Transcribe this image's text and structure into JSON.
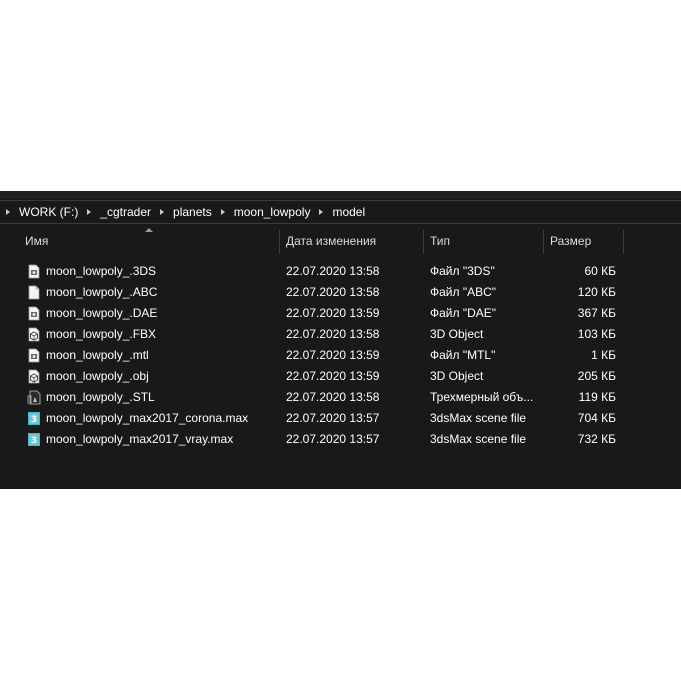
{
  "breadcrumb": [
    "WORK (F:)",
    "_cgtrader",
    "planets",
    "moon_lowpoly",
    "model"
  ],
  "columns": {
    "name": "Имя",
    "date": "Дата изменения",
    "type": "Тип",
    "size": "Размер"
  },
  "files": [
    {
      "name": "moon_lowpoly_.3DS",
      "date": "22.07.2020 13:58",
      "type": "Файл \"3DS\"",
      "size": "60 КБ",
      "icon": "generic-file-icon"
    },
    {
      "name": "moon_lowpoly_.ABC",
      "date": "22.07.2020 13:58",
      "type": "Файл \"ABC\"",
      "size": "120 КБ",
      "icon": "blank-file-icon"
    },
    {
      "name": "moon_lowpoly_.DAE",
      "date": "22.07.2020 13:59",
      "type": "Файл \"DAE\"",
      "size": "367 КБ",
      "icon": "generic-file-icon"
    },
    {
      "name": "moon_lowpoly_.FBX",
      "date": "22.07.2020 13:58",
      "type": "3D Object",
      "size": "103 КБ",
      "icon": "3d-object-icon"
    },
    {
      "name": "moon_lowpoly_.mtl",
      "date": "22.07.2020 13:59",
      "type": "Файл \"MTL\"",
      "size": "1 КБ",
      "icon": "generic-file-icon"
    },
    {
      "name": "moon_lowpoly_.obj",
      "date": "22.07.2020 13:59",
      "type": "3D Object",
      "size": "205 КБ",
      "icon": "3d-object-icon"
    },
    {
      "name": "moon_lowpoly_.STL",
      "date": "22.07.2020 13:58",
      "type": "Трехмерный объ...",
      "size": "119 КБ",
      "icon": "stl-file-icon"
    },
    {
      "name": "moon_lowpoly_max2017_corona.max",
      "date": "22.07.2020 13:57",
      "type": "3dsMax scene file",
      "size": "704 КБ",
      "icon": "3dsmax-icon"
    },
    {
      "name": "moon_lowpoly_max2017_vray.max",
      "date": "22.07.2020 13:57",
      "type": "3dsMax scene file",
      "size": "732 КБ",
      "icon": "3dsmax-icon"
    }
  ],
  "colors": {
    "window_bg": "#191919",
    "text": "#ffffff",
    "header_text": "#dcdcdc",
    "max_icon": "#40b8c8"
  }
}
